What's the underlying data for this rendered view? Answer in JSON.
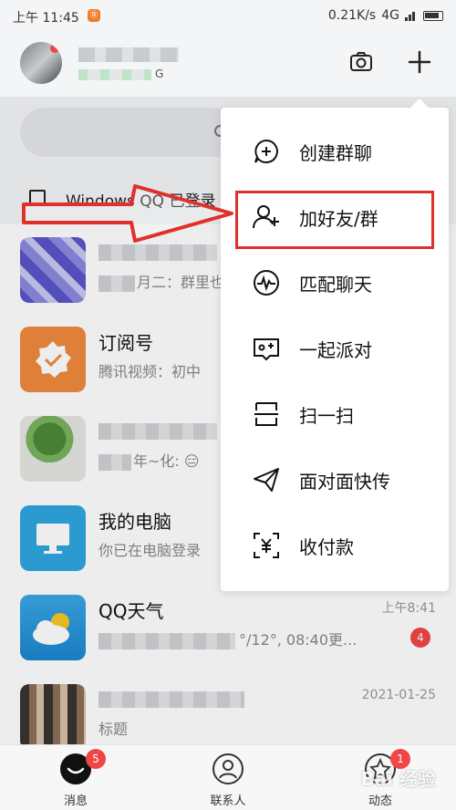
{
  "status_bar": {
    "time": "上午 11:45",
    "notif_icon_text": "Ⓑ",
    "net_speed": "0.21K/s",
    "network": "4G"
  },
  "header": {
    "sub_suffix": "G"
  },
  "windows_row": {
    "text": "Windows QQ 已登录"
  },
  "chats": [
    {
      "name": "",
      "preview": "月二：群里也",
      "time": ""
    },
    {
      "name": "订阅号",
      "preview": "腾讯视频：初中",
      "time": ""
    },
    {
      "name": "",
      "preview": "年~化: 😑",
      "time": ""
    },
    {
      "name": "我的电脑",
      "preview": "你已在电脑登录",
      "time": ""
    },
    {
      "name": "QQ天气",
      "preview": "°/12°, 08:40更...",
      "time": "上午8:41",
      "badge": "4"
    },
    {
      "name": "",
      "preview": "标题",
      "time": "2021-01-25"
    }
  ],
  "menu": {
    "items": [
      {
        "label": "创建群聊",
        "icon": "create-group-icon"
      },
      {
        "label": "加好友/群",
        "icon": "add-friend-icon"
      },
      {
        "label": "匹配聊天",
        "icon": "match-chat-icon"
      },
      {
        "label": "一起派对",
        "icon": "party-icon"
      },
      {
        "label": "扫一扫",
        "icon": "scan-icon"
      },
      {
        "label": "面对面快传",
        "icon": "send-icon"
      },
      {
        "label": "收付款",
        "icon": "payment-icon"
      }
    ]
  },
  "tabbar": {
    "tabs": [
      {
        "label": "消息",
        "badge": "5"
      },
      {
        "label": "联系人"
      },
      {
        "label": "动态",
        "badge": "1"
      }
    ]
  },
  "watermark": "Bai 经验",
  "colors": {
    "accent_red": "#e0302c",
    "badge_red": "#f04646"
  }
}
